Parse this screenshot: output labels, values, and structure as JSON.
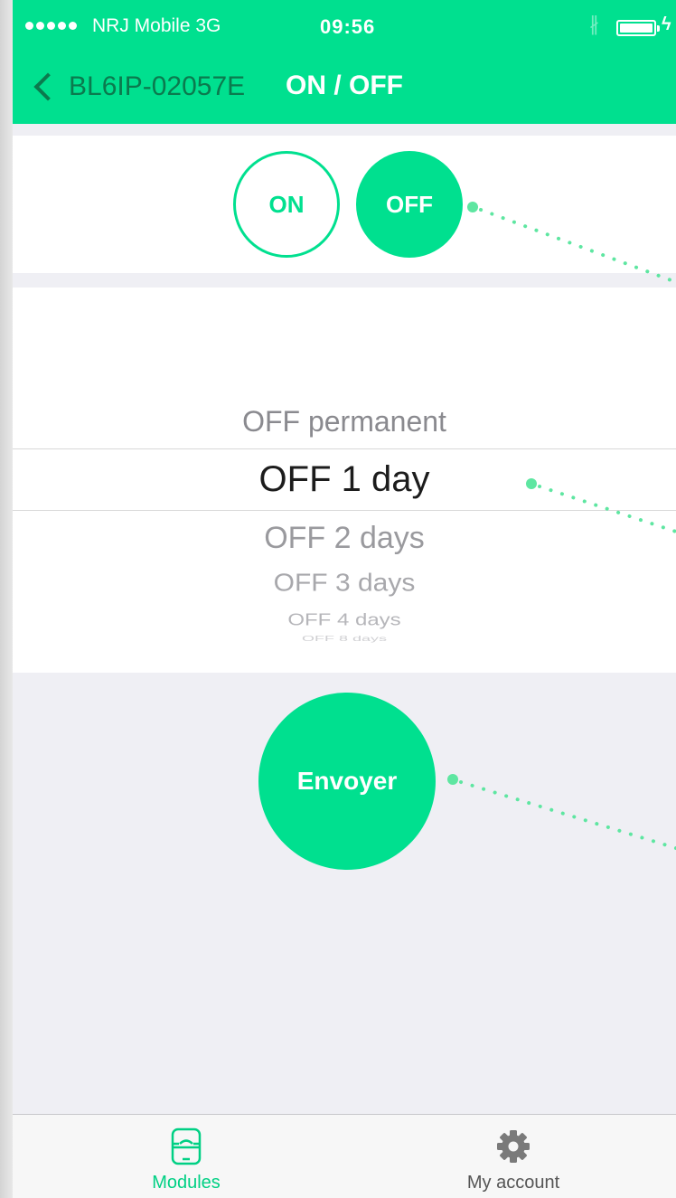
{
  "status_bar": {
    "carrier": "NRJ Mobile  3G",
    "time": "09:56",
    "bluetooth_icon": "bluetooth-icon",
    "battery_icon": "battery-icon",
    "charge_icon": "charging-icon"
  },
  "nav": {
    "back_label": "BL6IP-02057E",
    "title": "ON / OFF",
    "back_icon": "chevron-left-icon"
  },
  "toggle": {
    "on_label": "ON",
    "off_label": "OFF",
    "selected": "OFF"
  },
  "picker": {
    "options": [
      "OFF permanent",
      "OFF 1 day",
      "OFF 2 days",
      "OFF 3 days",
      "OFF 4 days",
      "OFF 8 days"
    ],
    "selected": "OFF 1 day"
  },
  "send": {
    "label": "Envoyer"
  },
  "tab_bar": {
    "tabs": [
      {
        "label": "Modules",
        "icon": "module-icon",
        "active": true
      },
      {
        "label": "My account",
        "icon": "gear-icon",
        "active": false
      }
    ]
  },
  "colors": {
    "accent": "#00e08f",
    "back_text": "#0b7a4e",
    "background": "#efeff4",
    "annotation": "#5ee6a1"
  }
}
